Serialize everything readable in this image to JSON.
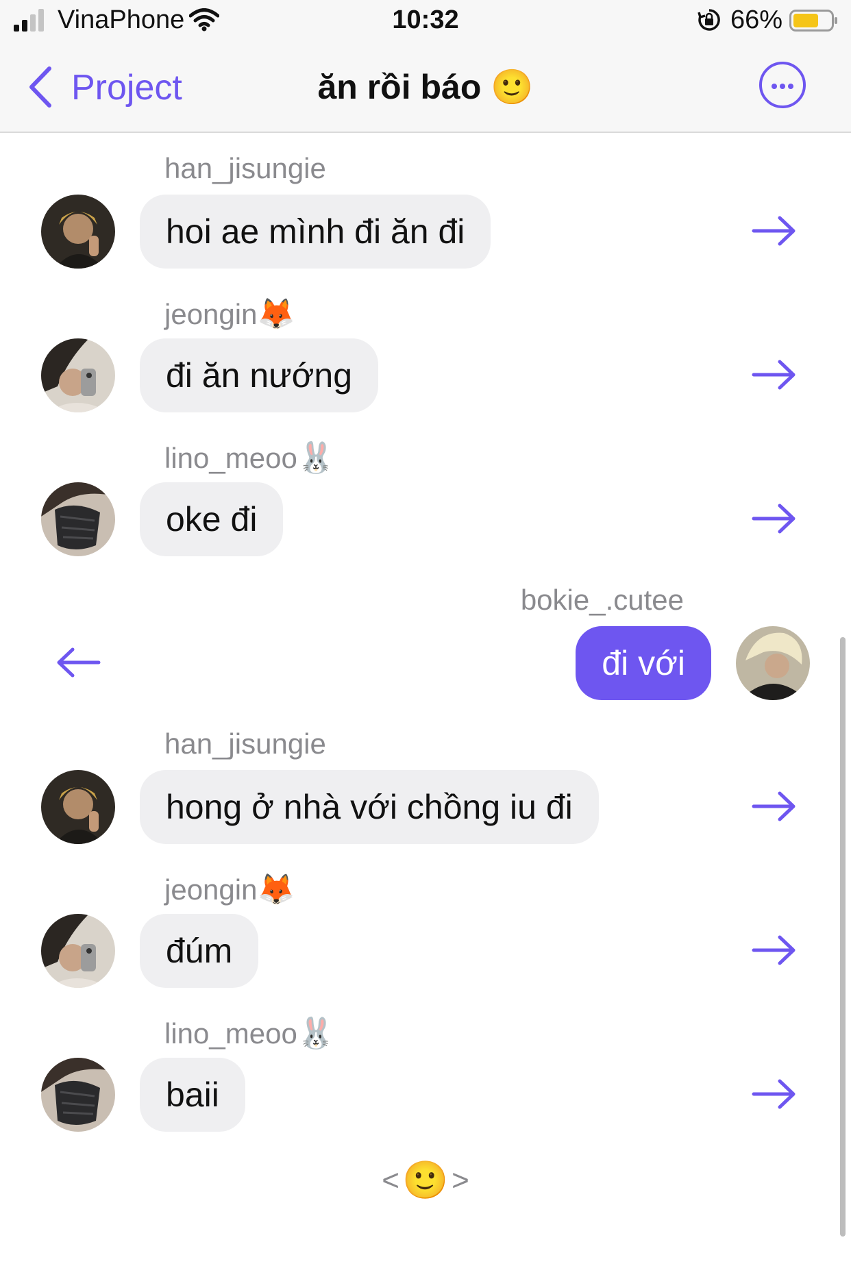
{
  "status_bar": {
    "carrier": "VinaPhone",
    "time": "10:32",
    "battery": "66%",
    "icons": [
      "signal-icon",
      "wifi-icon",
      "rotation-lock-icon",
      "battery-icon"
    ]
  },
  "nav": {
    "back_label": "Project",
    "title": "ăn rồi báo 🙂",
    "more_icon": "more-icon"
  },
  "messages": [
    {
      "sender": "han_jisungie",
      "sender_emoji": "",
      "text": "hoi ae mình đi ăn đi",
      "direction": "incoming"
    },
    {
      "sender": "jeongin",
      "sender_emoji": "🦊",
      "text": "đi ăn nướng",
      "direction": "incoming"
    },
    {
      "sender": "lino_meoo",
      "sender_emoji": "🐰",
      "text": "oke đi",
      "direction": "incoming"
    },
    {
      "sender": "bokie_.cutee",
      "sender_emoji": "",
      "text": "đi với",
      "direction": "outgoing"
    },
    {
      "sender": "han_jisungie",
      "sender_emoji": "",
      "text": "hong ở nhà với chồng iu đi",
      "direction": "incoming"
    },
    {
      "sender": "jeongin",
      "sender_emoji": "🦊",
      "text": "đúm",
      "direction": "incoming"
    },
    {
      "sender": "lino_meoo",
      "sender_emoji": "🐰",
      "text": "baii",
      "direction": "incoming"
    }
  ],
  "footer": {
    "prev": "<",
    "emoji": "🙂",
    "next": ">"
  },
  "colors": {
    "accent": "#6e56f0",
    "incoming_bubble": "#efeff1",
    "sender_text": "#8a8a8e"
  }
}
